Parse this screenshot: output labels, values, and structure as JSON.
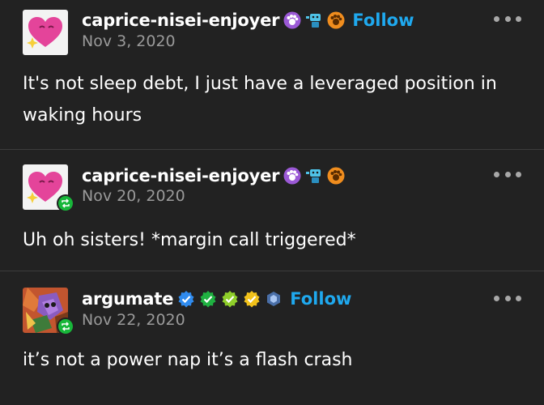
{
  "posts": [
    {
      "username": "caprice-nisei-enjoyer",
      "date": "Nov 3, 2020",
      "follow_label": "Follow",
      "body": "It's not sleep debt, I just have a leveraged position in waking hours",
      "badges": [
        "purple-paw-badge",
        "blue-robot-badge",
        "orange-paw-badge"
      ],
      "reblog": false
    },
    {
      "username": "caprice-nisei-enjoyer",
      "date": "Nov 20, 2020",
      "body": "Uh oh sisters! *margin call triggered*",
      "badges": [
        "purple-paw-badge",
        "blue-robot-badge",
        "orange-paw-badge"
      ],
      "reblog": true
    },
    {
      "username": "argumate",
      "date": "Nov 22, 2020",
      "follow_label": "Follow",
      "body": "it’s not a power nap it’s a flash crash",
      "badges": [
        "blue-verified-badge",
        "green-verified-badge",
        "lime-verified-badge",
        "yellow-verified-badge",
        "blue-hexagon-badge"
      ],
      "reblog": true
    }
  ],
  "icons": {
    "more": "more-options-icon",
    "reblog": "reblog-icon"
  },
  "colors": {
    "background": "#222222",
    "follow": "#1fa9ef",
    "date": "#9a9a9a",
    "reblog_badge": "#18b73a",
    "avatar_heart": "#e4449a"
  }
}
